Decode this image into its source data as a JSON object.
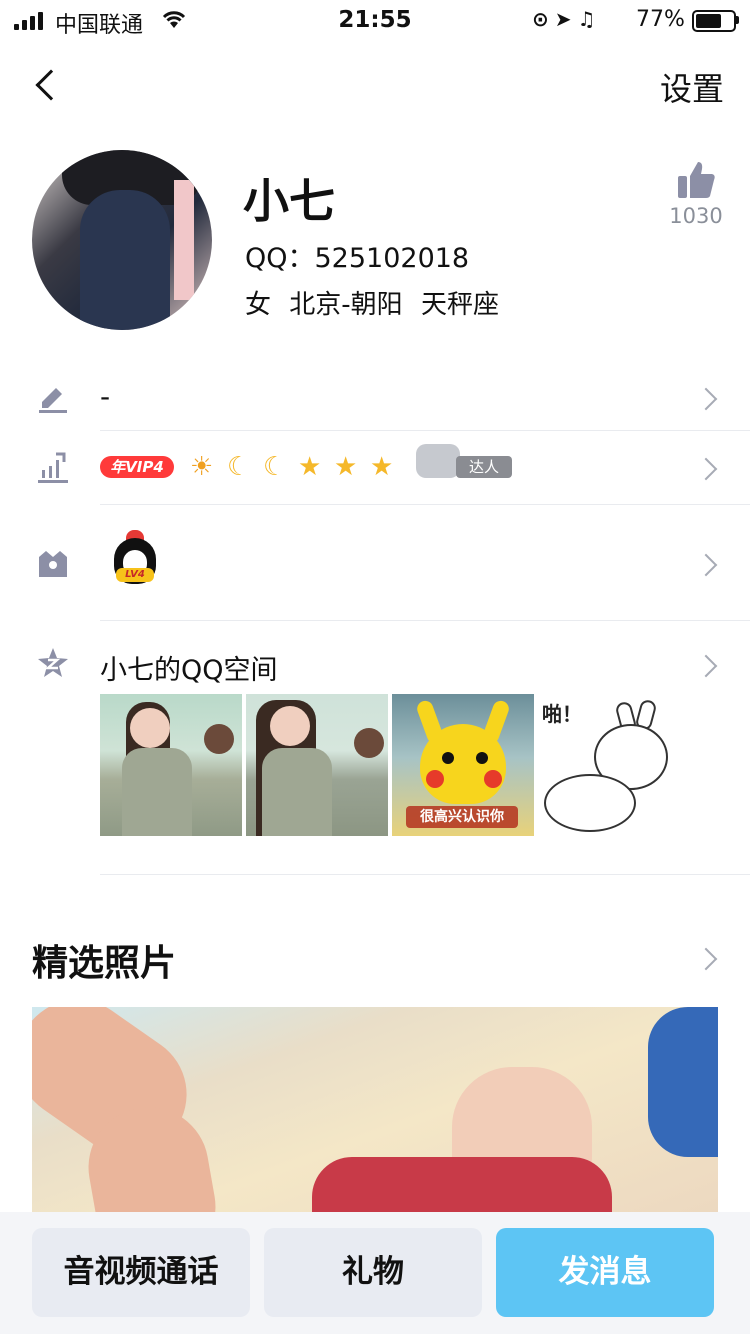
{
  "status_bar": {
    "carrier": "中国联通",
    "time": "21:55",
    "battery_percent": "77%",
    "battery_level": 0.77
  },
  "nav": {
    "back_icon": "chevron-left-icon",
    "settings_label": "设置"
  },
  "profile": {
    "name": "小七",
    "qq": "QQ：525102018",
    "gender": "女",
    "location": "北京-朝阳",
    "constellation": "天秤座",
    "like_count": "1030"
  },
  "rows": {
    "signature": "-",
    "vip_badge": "年VIP4",
    "level_icons": [
      "sun-icon",
      "moon-icon",
      "moon-icon",
      "star-icon",
      "star-icon",
      "star-icon"
    ],
    "daren_label": "达人",
    "pet_level": "LV4",
    "qzone_title": "小七的QQ空间",
    "qzone_photos": [
      {
        "caption": ""
      },
      {
        "caption": ""
      },
      {
        "caption": "很高兴认识你"
      },
      {
        "caption": "啪！"
      }
    ]
  },
  "featured": {
    "title": "精选照片"
  },
  "actions": {
    "call_label": "音视频通话",
    "gift_label": "礼物",
    "message_label": "发消息"
  },
  "colors": {
    "accent": "#5dc5f4",
    "vip": "#ff3a3a",
    "icon_gray": "#8c8fa6"
  }
}
